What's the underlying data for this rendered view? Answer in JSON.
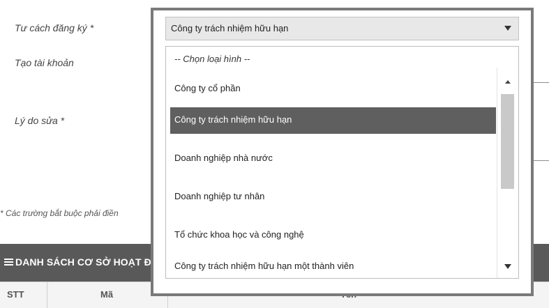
{
  "form": {
    "registration_label": "Tư cách đăng ký *",
    "account_label": "Tạo tài khoản",
    "reason_label": "Lý do sửa *",
    "required_hint": "* Các trường bắt buộc phải điền"
  },
  "select": {
    "value": "Công ty trách nhiệm hữu hạn",
    "icon": "chevron-down-icon",
    "options": [
      {
        "label": "-- Chọn loại hình --"
      },
      {
        "label": "Công ty cổ phần"
      },
      {
        "label": "Công ty trách nhiệm hữu hạn"
      },
      {
        "label": "Doanh nghiệp nhà nước"
      },
      {
        "label": "Doanh nghiệp tư nhân"
      },
      {
        "label": "Tổ chức khoa học và công nghệ"
      },
      {
        "label": "Công ty trách nhiệm hữu hạn một thành viên"
      }
    ],
    "selected_index": 2,
    "scroll_position": 0.15
  },
  "section": {
    "icon": "list-icon",
    "title": "DANH SÁCH CƠ SỞ HOẠT ĐỘNG"
  },
  "table": {
    "columns": [
      "STT",
      "Mã",
      "Tên"
    ]
  },
  "colors": {
    "section_bar": "#595959",
    "selected_option": "#5f5f5f",
    "frame": "#7a7a7a"
  }
}
